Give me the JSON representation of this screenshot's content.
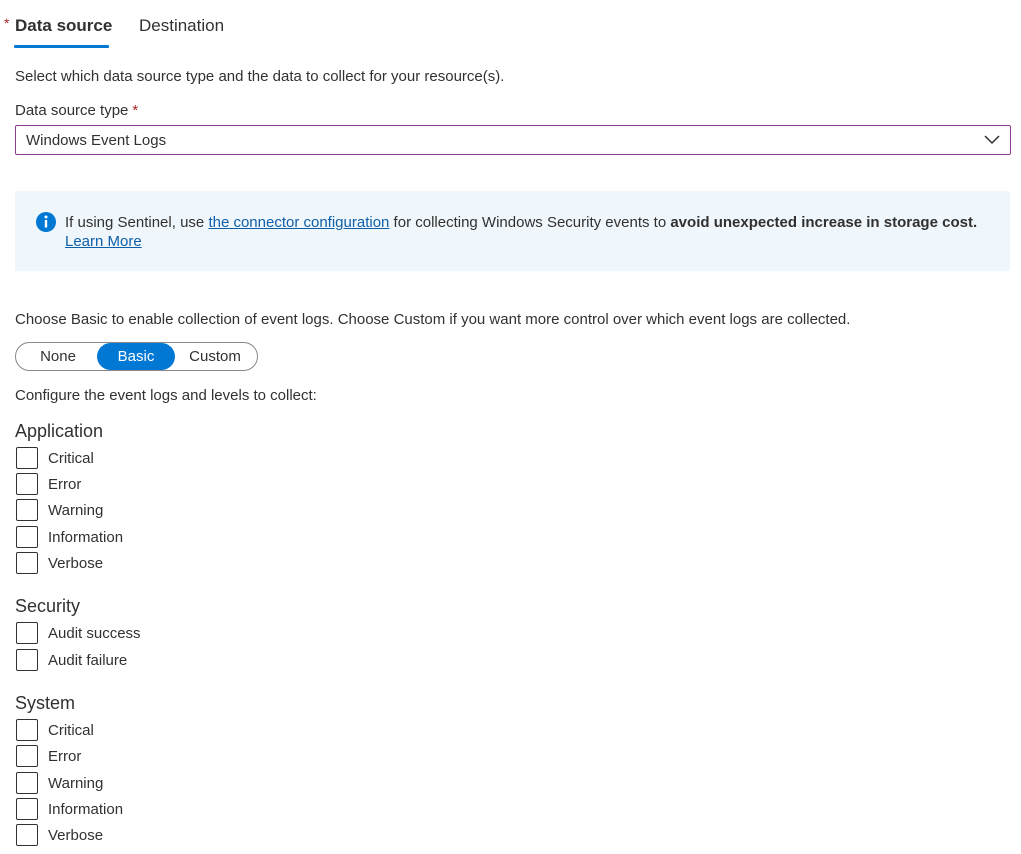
{
  "tabs": {
    "required_marker": "*",
    "data_source": "Data source",
    "destination": "Destination"
  },
  "intro": "Select which data source type and the data to collect for your resource(s).",
  "data_source_type": {
    "label": "Data source type",
    "required_marker": "*",
    "selected": "Windows Event Logs"
  },
  "banner": {
    "prefix": "If using Sentinel, use ",
    "link": "the connector configuration",
    "middle": " for collecting Windows Security events to ",
    "bold": "avoid unexpected increase in storage cost.",
    "learn_more": "Learn More"
  },
  "choose_text": "Choose Basic to enable collection of event logs. Choose Custom if you want more control over which event logs are collected.",
  "toggle": {
    "options": [
      "None",
      "Basic",
      "Custom"
    ],
    "selected": "Basic"
  },
  "configure_text": "Configure the event logs and levels to collect:",
  "sections": [
    {
      "title": "Application",
      "items": [
        "Critical",
        "Error",
        "Warning",
        "Information",
        "Verbose"
      ]
    },
    {
      "title": "Security",
      "items": [
        "Audit success",
        "Audit failure"
      ]
    },
    {
      "title": "System",
      "items": [
        "Critical",
        "Error",
        "Warning",
        "Information",
        "Verbose"
      ]
    }
  ],
  "colors": {
    "accent": "#0078d4",
    "required": "#a4262c",
    "banner_bg": "#eff6fc",
    "link": "#0f5fa8",
    "dropdown_border": "#8a3d8f"
  }
}
